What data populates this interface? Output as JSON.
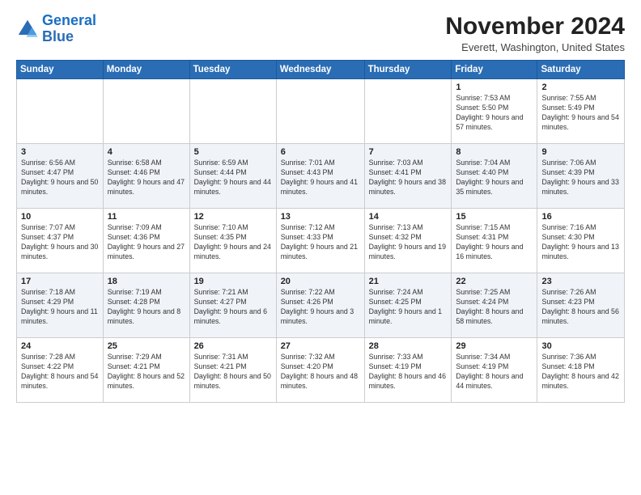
{
  "logo": {
    "line1": "General",
    "line2": "Blue"
  },
  "title": "November 2024",
  "location": "Everett, Washington, United States",
  "days_of_week": [
    "Sunday",
    "Monday",
    "Tuesday",
    "Wednesday",
    "Thursday",
    "Friday",
    "Saturday"
  ],
  "weeks": [
    [
      {
        "day": "",
        "info": ""
      },
      {
        "day": "",
        "info": ""
      },
      {
        "day": "",
        "info": ""
      },
      {
        "day": "",
        "info": ""
      },
      {
        "day": "",
        "info": ""
      },
      {
        "day": "1",
        "info": "Sunrise: 7:53 AM\nSunset: 5:50 PM\nDaylight: 9 hours and 57 minutes."
      },
      {
        "day": "2",
        "info": "Sunrise: 7:55 AM\nSunset: 5:49 PM\nDaylight: 9 hours and 54 minutes."
      }
    ],
    [
      {
        "day": "3",
        "info": "Sunrise: 6:56 AM\nSunset: 4:47 PM\nDaylight: 9 hours and 50 minutes."
      },
      {
        "day": "4",
        "info": "Sunrise: 6:58 AM\nSunset: 4:46 PM\nDaylight: 9 hours and 47 minutes."
      },
      {
        "day": "5",
        "info": "Sunrise: 6:59 AM\nSunset: 4:44 PM\nDaylight: 9 hours and 44 minutes."
      },
      {
        "day": "6",
        "info": "Sunrise: 7:01 AM\nSunset: 4:43 PM\nDaylight: 9 hours and 41 minutes."
      },
      {
        "day": "7",
        "info": "Sunrise: 7:03 AM\nSunset: 4:41 PM\nDaylight: 9 hours and 38 minutes."
      },
      {
        "day": "8",
        "info": "Sunrise: 7:04 AM\nSunset: 4:40 PM\nDaylight: 9 hours and 35 minutes."
      },
      {
        "day": "9",
        "info": "Sunrise: 7:06 AM\nSunset: 4:39 PM\nDaylight: 9 hours and 33 minutes."
      }
    ],
    [
      {
        "day": "10",
        "info": "Sunrise: 7:07 AM\nSunset: 4:37 PM\nDaylight: 9 hours and 30 minutes."
      },
      {
        "day": "11",
        "info": "Sunrise: 7:09 AM\nSunset: 4:36 PM\nDaylight: 9 hours and 27 minutes."
      },
      {
        "day": "12",
        "info": "Sunrise: 7:10 AM\nSunset: 4:35 PM\nDaylight: 9 hours and 24 minutes."
      },
      {
        "day": "13",
        "info": "Sunrise: 7:12 AM\nSunset: 4:33 PM\nDaylight: 9 hours and 21 minutes."
      },
      {
        "day": "14",
        "info": "Sunrise: 7:13 AM\nSunset: 4:32 PM\nDaylight: 9 hours and 19 minutes."
      },
      {
        "day": "15",
        "info": "Sunrise: 7:15 AM\nSunset: 4:31 PM\nDaylight: 9 hours and 16 minutes."
      },
      {
        "day": "16",
        "info": "Sunrise: 7:16 AM\nSunset: 4:30 PM\nDaylight: 9 hours and 13 minutes."
      }
    ],
    [
      {
        "day": "17",
        "info": "Sunrise: 7:18 AM\nSunset: 4:29 PM\nDaylight: 9 hours and 11 minutes."
      },
      {
        "day": "18",
        "info": "Sunrise: 7:19 AM\nSunset: 4:28 PM\nDaylight: 9 hours and 8 minutes."
      },
      {
        "day": "19",
        "info": "Sunrise: 7:21 AM\nSunset: 4:27 PM\nDaylight: 9 hours and 6 minutes."
      },
      {
        "day": "20",
        "info": "Sunrise: 7:22 AM\nSunset: 4:26 PM\nDaylight: 9 hours and 3 minutes."
      },
      {
        "day": "21",
        "info": "Sunrise: 7:24 AM\nSunset: 4:25 PM\nDaylight: 9 hours and 1 minute."
      },
      {
        "day": "22",
        "info": "Sunrise: 7:25 AM\nSunset: 4:24 PM\nDaylight: 8 hours and 58 minutes."
      },
      {
        "day": "23",
        "info": "Sunrise: 7:26 AM\nSunset: 4:23 PM\nDaylight: 8 hours and 56 minutes."
      }
    ],
    [
      {
        "day": "24",
        "info": "Sunrise: 7:28 AM\nSunset: 4:22 PM\nDaylight: 8 hours and 54 minutes."
      },
      {
        "day": "25",
        "info": "Sunrise: 7:29 AM\nSunset: 4:21 PM\nDaylight: 8 hours and 52 minutes."
      },
      {
        "day": "26",
        "info": "Sunrise: 7:31 AM\nSunset: 4:21 PM\nDaylight: 8 hours and 50 minutes."
      },
      {
        "day": "27",
        "info": "Sunrise: 7:32 AM\nSunset: 4:20 PM\nDaylight: 8 hours and 48 minutes."
      },
      {
        "day": "28",
        "info": "Sunrise: 7:33 AM\nSunset: 4:19 PM\nDaylight: 8 hours and 46 minutes."
      },
      {
        "day": "29",
        "info": "Sunrise: 7:34 AM\nSunset: 4:19 PM\nDaylight: 8 hours and 44 minutes."
      },
      {
        "day": "30",
        "info": "Sunrise: 7:36 AM\nSunset: 4:18 PM\nDaylight: 8 hours and 42 minutes."
      }
    ]
  ]
}
